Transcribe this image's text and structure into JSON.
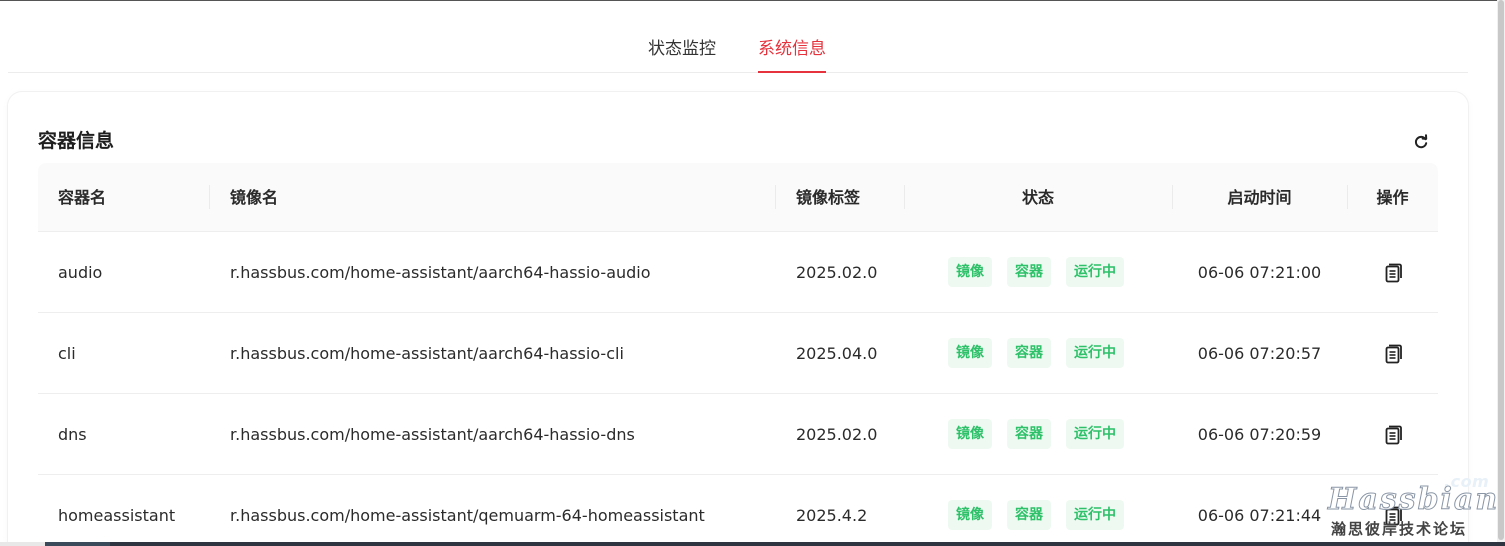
{
  "tabs": [
    {
      "label": "状态监控",
      "active": false
    },
    {
      "label": "系统信息",
      "active": true
    }
  ],
  "accent_color": "#e5323c",
  "status_tag_color": "#2ec16a",
  "card": {
    "title": "容器信息",
    "refresh_icon": "refresh-icon"
  },
  "table": {
    "headers": [
      "容器名",
      "镜像名",
      "镜像标签",
      "状态",
      "启动时间",
      "操作"
    ],
    "rows": [
      {
        "name": "audio",
        "image": "r.hassbus.com/home-assistant/aarch64-hassio-audio",
        "tag": "2025.02.0",
        "status": [
          "镜像",
          "容器",
          "运行中"
        ],
        "start_time": "06-06 07:21:00",
        "action_icon": "document-icon"
      },
      {
        "name": "cli",
        "image": "r.hassbus.com/home-assistant/aarch64-hassio-cli",
        "tag": "2025.04.0",
        "status": [
          "镜像",
          "容器",
          "运行中"
        ],
        "start_time": "06-06 07:20:57",
        "action_icon": "document-icon"
      },
      {
        "name": "dns",
        "image": "r.hassbus.com/home-assistant/aarch64-hassio-dns",
        "tag": "2025.02.0",
        "status": [
          "镜像",
          "容器",
          "运行中"
        ],
        "start_time": "06-06 07:20:59",
        "action_icon": "document-icon"
      },
      {
        "name": "homeassistant",
        "image": "r.hassbus.com/home-assistant/qemuarm-64-homeassistant",
        "tag": "2025.4.2",
        "status": [
          "镜像",
          "容器",
          "运行中"
        ],
        "start_time": "06-06 07:21:44",
        "action_icon": "document-icon"
      }
    ]
  },
  "watermark": {
    "com": ".com",
    "brand": "Hassbian",
    "subtitle": "瀚思彼岸技术论坛"
  }
}
